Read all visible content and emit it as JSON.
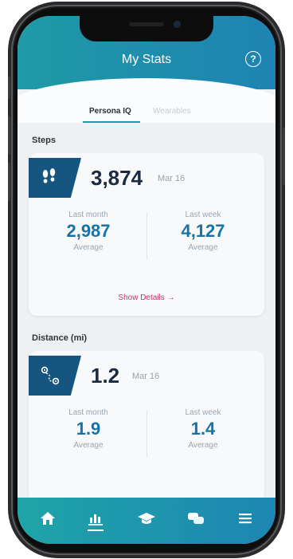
{
  "header": {
    "title": "My Stats",
    "help_glyph": "?"
  },
  "tabs": [
    {
      "label": "Persona IQ",
      "active": true
    },
    {
      "label": "Wearables",
      "active": false
    }
  ],
  "steps": {
    "section": "Steps",
    "value": "3,874",
    "date": "Mar 16",
    "last_month": {
      "label": "Last month",
      "value": "2,987",
      "sub": "Average"
    },
    "last_week": {
      "label": "Last week",
      "value": "4,127",
      "sub": "Average"
    },
    "details": "Show Details →"
  },
  "distance": {
    "section": "Distance (mi)",
    "value": "1.2",
    "date": "Mar 16",
    "last_month": {
      "label": "Last month",
      "value": "1.9",
      "sub": "Average"
    },
    "last_week": {
      "label": "Last week",
      "value": "1.4",
      "sub": "Average"
    }
  },
  "nav": [
    "home-icon",
    "stats-icon",
    "education-icon",
    "chat-icon",
    "menu-icon"
  ],
  "colors": {
    "header": "#1f9aa6",
    "badge": "#15557f",
    "accent_value": "#1672a8",
    "details_link": "#c4336e"
  }
}
